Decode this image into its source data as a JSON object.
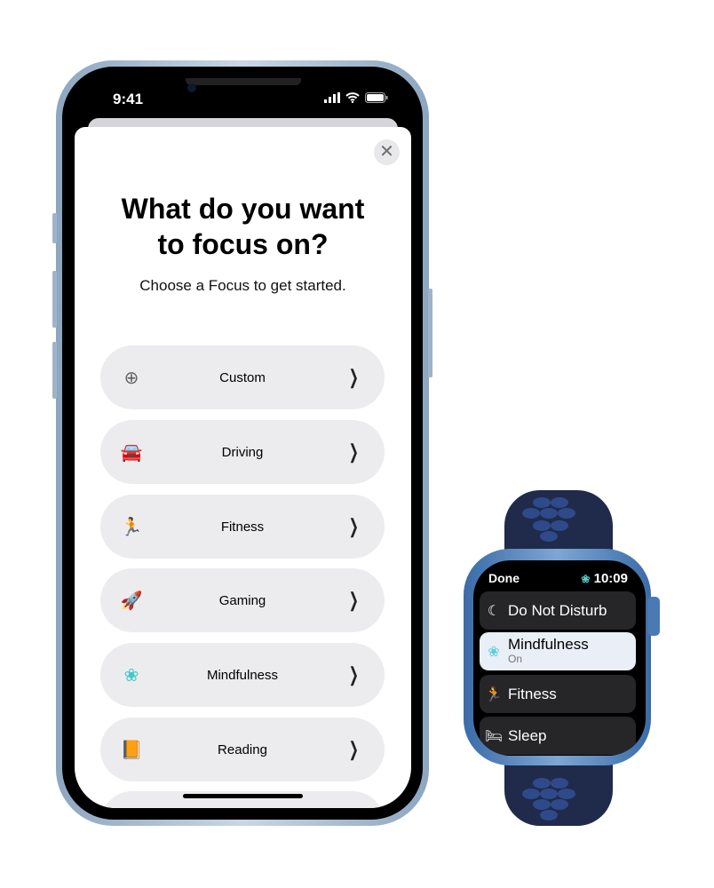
{
  "phone": {
    "status_time": "9:41",
    "status_icons": [
      "cellular-signal-icon",
      "wifi-icon",
      "battery-icon"
    ],
    "title": "What do you want to focus on?",
    "subtitle": "Choose a Focus to get started.",
    "close_icon": "close-icon",
    "focus_options": [
      {
        "label": "Custom",
        "icon": "plus-circle-icon",
        "color": "#636366"
      },
      {
        "label": "Driving",
        "icon": "car-icon",
        "color": "#5e5ce6"
      },
      {
        "label": "Fitness",
        "icon": "running-figure-icon",
        "color": "#30d158"
      },
      {
        "label": "Gaming",
        "icon": "rocket-icon",
        "color": "#0a84ff"
      },
      {
        "label": "Mindfulness",
        "icon": "flower-icon",
        "color": "#40c8c8"
      },
      {
        "label": "Reading",
        "icon": "book-icon",
        "color": "#ff9f0a"
      }
    ]
  },
  "watch": {
    "done_label": "Done",
    "time": "10:09",
    "status_icon": "mindfulness-flower-icon",
    "items": [
      {
        "label": "Do Not Disturb",
        "icon": "moon-icon"
      },
      {
        "label": "Mindfulness",
        "status": "On",
        "icon": "flower-icon",
        "selected": true
      },
      {
        "label": "Fitness",
        "icon": "running-figure-icon"
      },
      {
        "label": "Sleep",
        "icon": "bed-icon"
      }
    ]
  }
}
